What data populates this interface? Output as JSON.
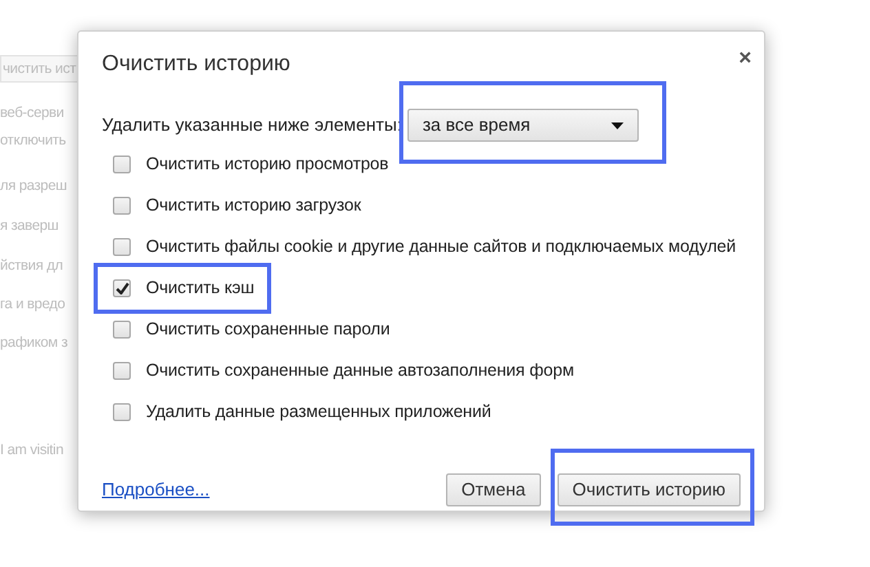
{
  "background_page": {
    "button": "чистить ист",
    "lines": [
      "веб-серви",
      "отключить",
      "ля разреш",
      "я заверш",
      "йствия дл",
      "га и вредо",
      "рафиком з",
      "I am visitin"
    ]
  },
  "dialog": {
    "title": "Очистить историю",
    "close": "×",
    "period": {
      "label": "Удалить указанные ниже элементы:",
      "value": "за все время",
      "highlighted": true
    },
    "items": [
      {
        "label": "Очистить историю просмотров",
        "checked": false,
        "highlighted": false
      },
      {
        "label": "Очистить историю загрузок",
        "checked": false,
        "highlighted": false
      },
      {
        "label": "Очистить файлы cookie и другие данные сайтов и подключаемых модулей",
        "checked": false,
        "highlighted": false
      },
      {
        "label": "Очистить кэш",
        "checked": true,
        "highlighted": true
      },
      {
        "label": "Очистить сохраненные пароли",
        "checked": false,
        "highlighted": false
      },
      {
        "label": "Очистить сохраненные данные автозаполнения форм",
        "checked": false,
        "highlighted": false
      },
      {
        "label": "Удалить данные размещенных приложений",
        "checked": false,
        "highlighted": false
      }
    ],
    "link": "Подробнее...",
    "buttons": [
      {
        "label": "Отмена",
        "highlighted": false
      },
      {
        "label": "Очистить историю",
        "highlighted": true
      }
    ]
  }
}
